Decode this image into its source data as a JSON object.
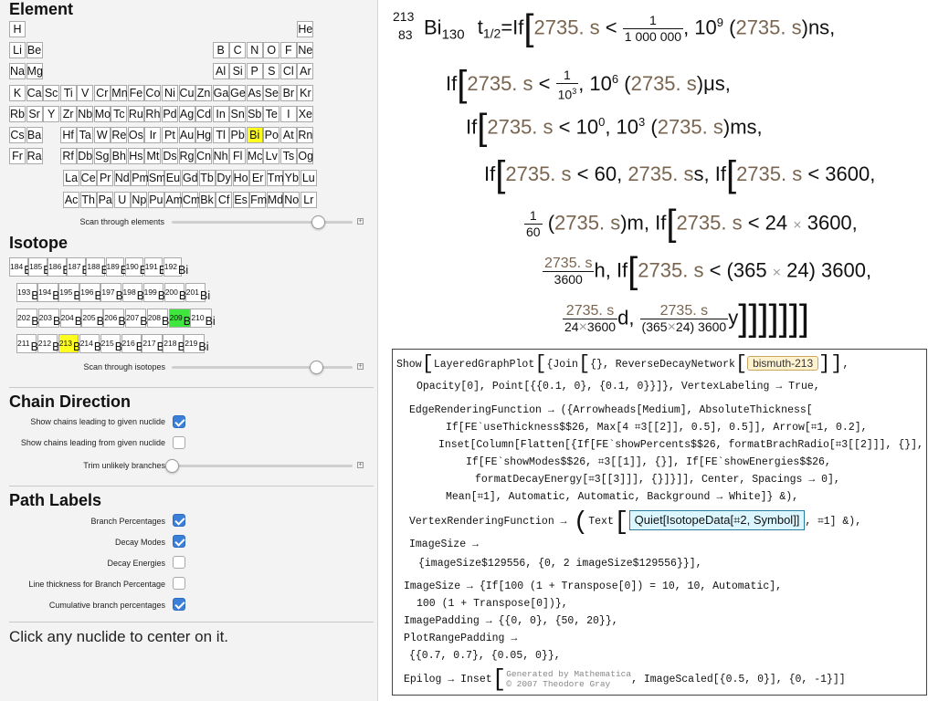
{
  "left": {
    "element_title": "Element",
    "periodic": [
      {
        "s": "H",
        "c": 1,
        "r": 1
      },
      {
        "s": "He",
        "c": 18,
        "r": 1
      },
      {
        "s": "Li",
        "c": 1,
        "r": 2
      },
      {
        "s": "Be",
        "c": 2,
        "r": 2
      },
      {
        "s": "B",
        "c": 13,
        "r": 2
      },
      {
        "s": "C",
        "c": 14,
        "r": 2
      },
      {
        "s": "N",
        "c": 15,
        "r": 2
      },
      {
        "s": "O",
        "c": 16,
        "r": 2
      },
      {
        "s": "F",
        "c": 17,
        "r": 2
      },
      {
        "s": "Ne",
        "c": 18,
        "r": 2
      },
      {
        "s": "Na",
        "c": 1,
        "r": 3
      },
      {
        "s": "Mg",
        "c": 2,
        "r": 3
      },
      {
        "s": "Al",
        "c": 13,
        "r": 3
      },
      {
        "s": "Si",
        "c": 14,
        "r": 3
      },
      {
        "s": "P",
        "c": 15,
        "r": 3
      },
      {
        "s": "S",
        "c": 16,
        "r": 3
      },
      {
        "s": "Cl",
        "c": 17,
        "r": 3
      },
      {
        "s": "Ar",
        "c": 18,
        "r": 3
      },
      {
        "s": "K",
        "c": 1,
        "r": 4
      },
      {
        "s": "Ca",
        "c": 2,
        "r": 4
      },
      {
        "s": "Sc",
        "c": 3,
        "r": 4
      },
      {
        "s": "Ti",
        "c": 4,
        "r": 4
      },
      {
        "s": "V",
        "c": 5,
        "r": 4
      },
      {
        "s": "Cr",
        "c": 6,
        "r": 4
      },
      {
        "s": "Mn",
        "c": 7,
        "r": 4
      },
      {
        "s": "Fe",
        "c": 8,
        "r": 4
      },
      {
        "s": "Co",
        "c": 9,
        "r": 4
      },
      {
        "s": "Ni",
        "c": 10,
        "r": 4
      },
      {
        "s": "Cu",
        "c": 11,
        "r": 4
      },
      {
        "s": "Zn",
        "c": 12,
        "r": 4
      },
      {
        "s": "Ga",
        "c": 13,
        "r": 4
      },
      {
        "s": "Ge",
        "c": 14,
        "r": 4
      },
      {
        "s": "As",
        "c": 15,
        "r": 4
      },
      {
        "s": "Se",
        "c": 16,
        "r": 4
      },
      {
        "s": "Br",
        "c": 17,
        "r": 4
      },
      {
        "s": "Kr",
        "c": 18,
        "r": 4
      },
      {
        "s": "Rb",
        "c": 1,
        "r": 5
      },
      {
        "s": "Sr",
        "c": 2,
        "r": 5
      },
      {
        "s": "Y",
        "c": 3,
        "r": 5
      },
      {
        "s": "Zr",
        "c": 4,
        "r": 5
      },
      {
        "s": "Nb",
        "c": 5,
        "r": 5
      },
      {
        "s": "Mo",
        "c": 6,
        "r": 5
      },
      {
        "s": "Tc",
        "c": 7,
        "r": 5
      },
      {
        "s": "Ru",
        "c": 8,
        "r": 5
      },
      {
        "s": "Rh",
        "c": 9,
        "r": 5
      },
      {
        "s": "Pd",
        "c": 10,
        "r": 5
      },
      {
        "s": "Ag",
        "c": 11,
        "r": 5
      },
      {
        "s": "Cd",
        "c": 12,
        "r": 5
      },
      {
        "s": "In",
        "c": 13,
        "r": 5
      },
      {
        "s": "Sn",
        "c": 14,
        "r": 5
      },
      {
        "s": "Sb",
        "c": 15,
        "r": 5
      },
      {
        "s": "Te",
        "c": 16,
        "r": 5
      },
      {
        "s": "I",
        "c": 17,
        "r": 5
      },
      {
        "s": "Xe",
        "c": 18,
        "r": 5
      },
      {
        "s": "Cs",
        "c": 1,
        "r": 6
      },
      {
        "s": "Ba",
        "c": 2,
        "r": 6
      },
      {
        "s": "Hf",
        "c": 4,
        "r": 6
      },
      {
        "s": "Ta",
        "c": 5,
        "r": 6
      },
      {
        "s": "W",
        "c": 6,
        "r": 6
      },
      {
        "s": "Re",
        "c": 7,
        "r": 6
      },
      {
        "s": "Os",
        "c": 8,
        "r": 6
      },
      {
        "s": "Ir",
        "c": 9,
        "r": 6
      },
      {
        "s": "Pt",
        "c": 10,
        "r": 6
      },
      {
        "s": "Au",
        "c": 11,
        "r": 6
      },
      {
        "s": "Hg",
        "c": 12,
        "r": 6
      },
      {
        "s": "Tl",
        "c": 13,
        "r": 6
      },
      {
        "s": "Pb",
        "c": 14,
        "r": 6
      },
      {
        "s": "Bi",
        "c": 15,
        "r": 6,
        "hl": true
      },
      {
        "s": "Po",
        "c": 16,
        "r": 6
      },
      {
        "s": "At",
        "c": 17,
        "r": 6
      },
      {
        "s": "Rn",
        "c": 18,
        "r": 6
      },
      {
        "s": "Fr",
        "c": 1,
        "r": 7
      },
      {
        "s": "Ra",
        "c": 2,
        "r": 7
      },
      {
        "s": "Rf",
        "c": 4,
        "r": 7
      },
      {
        "s": "Db",
        "c": 5,
        "r": 7
      },
      {
        "s": "Sg",
        "c": 6,
        "r": 7
      },
      {
        "s": "Bh",
        "c": 7,
        "r": 7
      },
      {
        "s": "Hs",
        "c": 8,
        "r": 7
      },
      {
        "s": "Mt",
        "c": 9,
        "r": 7
      },
      {
        "s": "Ds",
        "c": 10,
        "r": 7
      },
      {
        "s": "Rg",
        "c": 11,
        "r": 7
      },
      {
        "s": "Cn",
        "c": 12,
        "r": 7
      },
      {
        "s": "Nh",
        "c": 13,
        "r": 7
      },
      {
        "s": "Fl",
        "c": 14,
        "r": 7
      },
      {
        "s": "Mc",
        "c": 15,
        "r": 7
      },
      {
        "s": "Lv",
        "c": 16,
        "r": 7
      },
      {
        "s": "Ts",
        "c": 17,
        "r": 7
      },
      {
        "s": "Og",
        "c": 18,
        "r": 7
      },
      {
        "s": "La",
        "c": 3,
        "r": 8
      },
      {
        "s": "Ce",
        "c": 4,
        "r": 8
      },
      {
        "s": "Pr",
        "c": 5,
        "r": 8
      },
      {
        "s": "Nd",
        "c": 6,
        "r": 8
      },
      {
        "s": "Pm",
        "c": 7,
        "r": 8
      },
      {
        "s": "Sm",
        "c": 8,
        "r": 8
      },
      {
        "s": "Eu",
        "c": 9,
        "r": 8
      },
      {
        "s": "Gd",
        "c": 10,
        "r": 8
      },
      {
        "s": "Tb",
        "c": 11,
        "r": 8
      },
      {
        "s": "Dy",
        "c": 12,
        "r": 8
      },
      {
        "s": "Ho",
        "c": 13,
        "r": 8
      },
      {
        "s": "Er",
        "c": 14,
        "r": 8
      },
      {
        "s": "Tm",
        "c": 15,
        "r": 8
      },
      {
        "s": "Yb",
        "c": 16,
        "r": 8
      },
      {
        "s": "Lu",
        "c": 17,
        "r": 8
      },
      {
        "s": "Ac",
        "c": 3,
        "r": 9
      },
      {
        "s": "Th",
        "c": 4,
        "r": 9
      },
      {
        "s": "Pa",
        "c": 5,
        "r": 9
      },
      {
        "s": "U",
        "c": 6,
        "r": 9
      },
      {
        "s": "Np",
        "c": 7,
        "r": 9
      },
      {
        "s": "Pu",
        "c": 8,
        "r": 9
      },
      {
        "s": "Am",
        "c": 9,
        "r": 9
      },
      {
        "s": "Cm",
        "c": 10,
        "r": 9
      },
      {
        "s": "Bk",
        "c": 11,
        "r": 9
      },
      {
        "s": "Cf",
        "c": 12,
        "r": 9
      },
      {
        "s": "Es",
        "c": 13,
        "r": 9
      },
      {
        "s": "Fm",
        "c": 14,
        "r": 9
      },
      {
        "s": "Md",
        "c": 15,
        "r": 9
      },
      {
        "s": "No",
        "c": 16,
        "r": 9
      },
      {
        "s": "Lr",
        "c": 17,
        "r": 9
      }
    ],
    "scan_elements_label": "Scan through elements",
    "scan_elements_value": 0.81,
    "isotope_title": "Isotope",
    "isotope_rows": [
      [
        {
          "m": "184",
          "s": "Bi"
        },
        {
          "m": "185",
          "s": "Bi"
        },
        {
          "m": "186",
          "s": "Bi"
        },
        {
          "m": "187",
          "s": "Bi"
        },
        {
          "m": "188",
          "s": "Bi"
        },
        {
          "m": "189",
          "s": "Bi"
        },
        {
          "m": "190",
          "s": "Bi"
        },
        {
          "m": "191",
          "s": "Bi"
        },
        {
          "m": "192",
          "s": "Bi"
        }
      ],
      [
        {
          "m": "193",
          "s": "Bi"
        },
        {
          "m": "194",
          "s": "Bi"
        },
        {
          "m": "195",
          "s": "Bi"
        },
        {
          "m": "196",
          "s": "Bi"
        },
        {
          "m": "197",
          "s": "Bi"
        },
        {
          "m": "198",
          "s": "Bi"
        },
        {
          "m": "199",
          "s": "Bi"
        },
        {
          "m": "200",
          "s": "Bi"
        },
        {
          "m": "201",
          "s": "Bi"
        }
      ],
      [
        {
          "m": "202",
          "s": "Bi"
        },
        {
          "m": "203",
          "s": "Bi"
        },
        {
          "m": "204",
          "s": "Bi"
        },
        {
          "m": "205",
          "s": "Bi"
        },
        {
          "m": "206",
          "s": "Bi"
        },
        {
          "m": "207",
          "s": "Bi"
        },
        {
          "m": "208",
          "s": "Bi"
        },
        {
          "m": "209",
          "s": "Bi",
          "g": true
        },
        {
          "m": "210",
          "s": "Bi"
        }
      ],
      [
        {
          "m": "211",
          "s": "Bi"
        },
        {
          "m": "212",
          "s": "Bi"
        },
        {
          "m": "213",
          "s": "Bi",
          "y": true
        },
        {
          "m": "214",
          "s": "Bi"
        },
        {
          "m": "215",
          "s": "Bi"
        },
        {
          "m": "216",
          "s": "Bi"
        },
        {
          "m": "217",
          "s": "Bi"
        },
        {
          "m": "218",
          "s": "Bi"
        },
        {
          "m": "219",
          "s": "Bi"
        }
      ]
    ],
    "scan_isotopes_label": "Scan through isotopes",
    "scan_isotopes_value": 0.8,
    "chain_title": "Chain Direction",
    "chain_options": [
      {
        "label": "Show chains leading to given nuclide",
        "checked": true
      },
      {
        "label": "Show chains leading from given nuclide",
        "checked": false
      }
    ],
    "trim_label": "Trim unlikely branches",
    "trim_value": 0.0,
    "path_title": "Path Labels",
    "path_options": [
      {
        "label": "Branch Percentages",
        "checked": true
      },
      {
        "label": "Decay Modes",
        "checked": true
      },
      {
        "label": "Decay Energies",
        "checked": false
      },
      {
        "label": "Line thickness for Branch Percentage",
        "checked": false
      },
      {
        "label": "Cumulative branch percentages",
        "checked": true
      }
    ],
    "click_note": "Click any nuclide to center on it."
  },
  "right": {
    "nuclide": {
      "mass": "213",
      "z": "83",
      "sym": "Bi",
      "n": "130"
    },
    "half_life_label": "t",
    "half_life_sub": "1/2",
    "val": "2735. s",
    "code": {
      "l1a": "Show",
      "l1b": "LayeredGraphPlot",
      "l1c": "{Join",
      "l1d": "{}, ReverseDecayNetwork",
      "l1tag": "bismuth-213",
      "l2": "Opacity[0], Point[{{0.1, 0}, {0.1, 0}}]}, VertexLabeling → True,",
      "l3": "EdgeRenderingFunction → ({Arrowheads[Medium], AbsoluteThickness[",
      "l4": "If[FE`useThickness$$26, Max[4 ⌗3[[2]], 0.5], 0.5]], Arrow[⌗1, 0.2],",
      "l5": "Inset[Column[Flatten[{If[FE`showPercents$$26, formatBrachRadio[⌗3[[2]]], {}],",
      "l6": "If[FE`showModes$$26, ⌗3[[1]], {}], If[FE`showEnergies$$26,",
      "l7": "formatDecayEnergy[⌗3[[3]]], {}]}]], Center, Spacings → 0],",
      "l8": "Mean[⌗1], Automatic, Automatic, Background → White]} &),",
      "l9a": "VertexRenderingFunction →",
      "l9b": "Text",
      "l9box": "Quiet[IsotopeData[⌗2, Symbol]]",
      "l9c": ", ⌗1] &),",
      "l10": "ImageSize →",
      "l11": "{imageSize$129556, {0, 2 imageSize$129556}}],",
      "l12": "ImageSize → {If[100 (1 + Transpose[0]) = 10, 10, Automatic],",
      "l13": "100 (1 + Transpose[0])},",
      "l14": "ImagePadding → {{0, 0}, {50, 20}},",
      "l15": "PlotRangePadding →",
      "l16": "{{0.7, 0.7}, {0.05, 0}},",
      "l17a": "Epilog → Inset",
      "l17s1": "Generated by Mathematica",
      "l17s2": "© 2007 Theodore Gray",
      "l17b": ", ImageScaled[{0.5, 0}], {0, -1}]]"
    }
  }
}
